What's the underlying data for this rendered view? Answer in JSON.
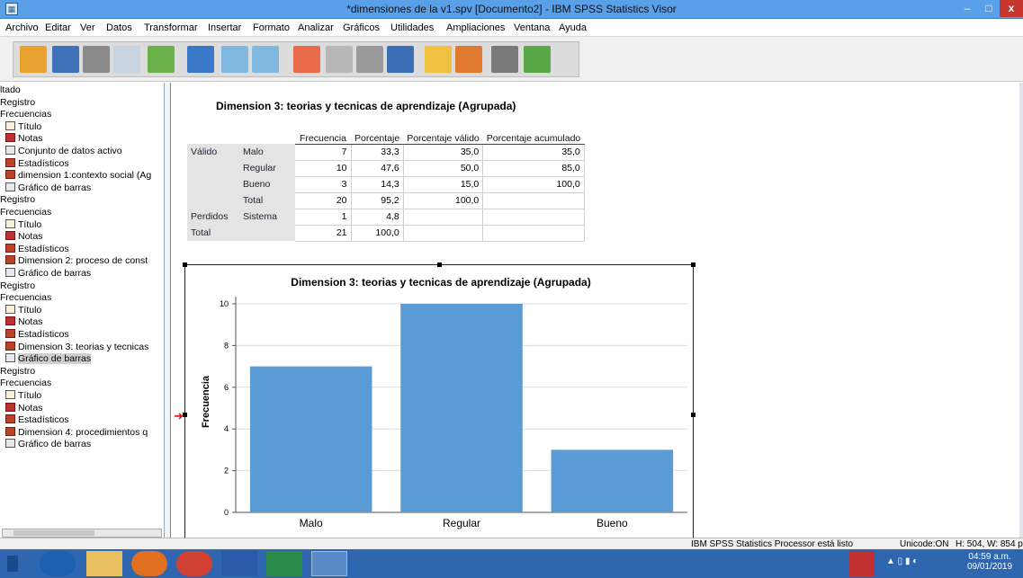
{
  "window": {
    "title": "*dimensiones de la v1.spv [Documento2] - IBM SPSS Statistics Visor",
    "minimize": "–",
    "maximize": "□",
    "close": "x"
  },
  "menu": [
    "Archivo",
    "Editar",
    "Ver",
    "Datos",
    "Transformar",
    "Insertar",
    "Formato",
    "Analizar",
    "Gráficos",
    "Utilidades",
    "Ampliaciones",
    "Ventana",
    "Ayuda"
  ],
  "toolbar_icons": [
    "open-folder-icon",
    "save-icon",
    "print-icon",
    "print-preview-icon",
    "export-icon",
    "goto-data-icon",
    "undo-icon",
    "redo-icon",
    "goto-case-icon",
    "goto-variable-icon",
    "weight-icon",
    "split-icon",
    "insert-output-icon",
    "designate-window-icon",
    "hide-icon",
    "show-icon"
  ],
  "outline": {
    "items": [
      {
        "label": "ltado",
        "icon": "none",
        "indent": 0
      },
      {
        "label": "Registro",
        "icon": "none",
        "indent": 0
      },
      {
        "label": "Frecuencias",
        "icon": "none",
        "indent": 0
      },
      {
        "label": "Título",
        "icon": "t",
        "indent": 1
      },
      {
        "label": "Notas",
        "icon": "n",
        "indent": 1
      },
      {
        "label": "Conjunto de datos activo",
        "icon": "c",
        "indent": 1
      },
      {
        "label": "Estadísticos",
        "icon": "s",
        "indent": 1
      },
      {
        "label": "dimension 1:contexto social (Ag",
        "icon": "s",
        "indent": 1
      },
      {
        "label": "Gráfico de barras",
        "icon": "c",
        "indent": 1
      },
      {
        "label": "Registro",
        "icon": "none",
        "indent": 0
      },
      {
        "label": "Frecuencias",
        "icon": "none",
        "indent": 0
      },
      {
        "label": "Título",
        "icon": "t",
        "indent": 1
      },
      {
        "label": "Notas",
        "icon": "n",
        "indent": 1
      },
      {
        "label": "Estadísticos",
        "icon": "s",
        "indent": 1
      },
      {
        "label": "Dimension 2: proceso de const",
        "icon": "s",
        "indent": 1
      },
      {
        "label": "Gráfico de barras",
        "icon": "c",
        "indent": 1
      },
      {
        "label": "Registro",
        "icon": "none",
        "indent": 0
      },
      {
        "label": "Frecuencias",
        "icon": "none",
        "indent": 0
      },
      {
        "label": "Título",
        "icon": "t",
        "indent": 1
      },
      {
        "label": "Notas",
        "icon": "n",
        "indent": 1
      },
      {
        "label": "Estadísticos",
        "icon": "s",
        "indent": 1
      },
      {
        "label": "Dimension 3: teorias y tecnicas",
        "icon": "s",
        "indent": 1
      },
      {
        "label": "Gráfico de barras",
        "icon": "c",
        "indent": 1,
        "selected": true
      },
      {
        "label": "Registro",
        "icon": "none",
        "indent": 0
      },
      {
        "label": "Frecuencias",
        "icon": "none",
        "indent": 0
      },
      {
        "label": "Título",
        "icon": "t",
        "indent": 1
      },
      {
        "label": "Notas",
        "icon": "n",
        "indent": 1
      },
      {
        "label": "Estadísticos",
        "icon": "s",
        "indent": 1
      },
      {
        "label": "Dimension 4: procedimientos q",
        "icon": "s",
        "indent": 1
      },
      {
        "label": "Gráfico de barras",
        "icon": "c",
        "indent": 1
      }
    ]
  },
  "table": {
    "title": "Dimension 3: teorias y tecnicas de aprendizaje (Agrupada)",
    "headers": [
      "Frecuencia",
      "Porcentaje",
      "Porcentaje válido",
      "Porcentaje acumulado"
    ],
    "rows": [
      {
        "group": "Válido",
        "label": "Malo",
        "vals": [
          "7",
          "33,3",
          "35,0",
          "35,0"
        ]
      },
      {
        "group": "",
        "label": "Regular",
        "vals": [
          "10",
          "47,6",
          "50,0",
          "85,0"
        ]
      },
      {
        "group": "",
        "label": "Bueno",
        "vals": [
          "3",
          "14,3",
          "15,0",
          "100,0"
        ]
      },
      {
        "group": "",
        "label": "Total",
        "vals": [
          "20",
          "95,2",
          "100,0",
          ""
        ]
      },
      {
        "group": "Perdidos",
        "label": "Sistema",
        "vals": [
          "1",
          "4,8",
          "",
          ""
        ]
      },
      {
        "group": "Total",
        "label": "",
        "vals": [
          "21",
          "100,0",
          "",
          ""
        ]
      }
    ]
  },
  "chart_data": {
    "type": "bar",
    "title": "Dimension 3: teorias y tecnicas de aprendizaje (Agrupada)",
    "categories": [
      "Malo",
      "Regular",
      "Bueno"
    ],
    "values": [
      7,
      10,
      3
    ],
    "xlabel": "",
    "ylabel": "Frecuencia",
    "ylim": [
      0,
      10
    ],
    "yticks": [
      0,
      2,
      4,
      6,
      8,
      10
    ],
    "grid": true,
    "bar_color": "#5b9bd5"
  },
  "status": {
    "processor": "IBM SPSS Statistics Processor está listo",
    "unicode": "Unicode:ON",
    "size": "H: 504, W: 854 p"
  },
  "taskbar": {
    "time": "04:59 a.m.",
    "date": "09/01/2019"
  }
}
